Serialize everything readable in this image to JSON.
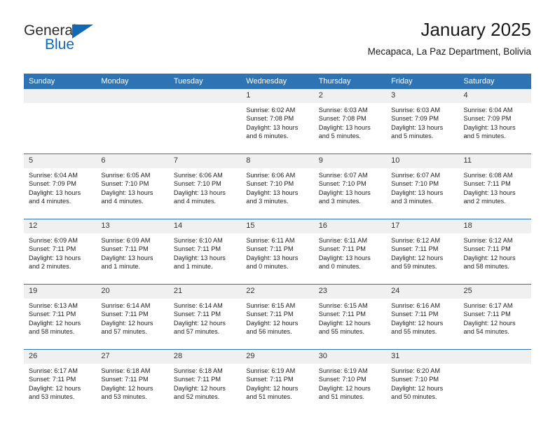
{
  "brand": {
    "name_part1": "General",
    "name_part2": "Blue"
  },
  "header": {
    "title": "January 2025",
    "subtitle": "Mecapaca, La Paz Department, Bolivia"
  },
  "colors": {
    "header_blue": "#2e74b5",
    "date_band_gray": "#f0f0f0",
    "brand_blue": "#1268b3"
  },
  "weekdays": [
    "Sunday",
    "Monday",
    "Tuesday",
    "Wednesday",
    "Thursday",
    "Friday",
    "Saturday"
  ],
  "weeks": [
    [
      {
        "day": "",
        "blank": true,
        "sunrise": "",
        "sunset": "",
        "daylight_line1": "",
        "daylight_line2": ""
      },
      {
        "day": "",
        "blank": true,
        "sunrise": "",
        "sunset": "",
        "daylight_line1": "",
        "daylight_line2": ""
      },
      {
        "day": "",
        "blank": true,
        "sunrise": "",
        "sunset": "",
        "daylight_line1": "",
        "daylight_line2": ""
      },
      {
        "day": "1",
        "sunrise": "Sunrise: 6:02 AM",
        "sunset": "Sunset: 7:08 PM",
        "daylight_line1": "Daylight: 13 hours",
        "daylight_line2": "and 6 minutes."
      },
      {
        "day": "2",
        "sunrise": "Sunrise: 6:03 AM",
        "sunset": "Sunset: 7:08 PM",
        "daylight_line1": "Daylight: 13 hours",
        "daylight_line2": "and 5 minutes."
      },
      {
        "day": "3",
        "sunrise": "Sunrise: 6:03 AM",
        "sunset": "Sunset: 7:09 PM",
        "daylight_line1": "Daylight: 13 hours",
        "daylight_line2": "and 5 minutes."
      },
      {
        "day": "4",
        "sunrise": "Sunrise: 6:04 AM",
        "sunset": "Sunset: 7:09 PM",
        "daylight_line1": "Daylight: 13 hours",
        "daylight_line2": "and 5 minutes."
      }
    ],
    [
      {
        "day": "5",
        "sunrise": "Sunrise: 6:04 AM",
        "sunset": "Sunset: 7:09 PM",
        "daylight_line1": "Daylight: 13 hours",
        "daylight_line2": "and 4 minutes."
      },
      {
        "day": "6",
        "sunrise": "Sunrise: 6:05 AM",
        "sunset": "Sunset: 7:10 PM",
        "daylight_line1": "Daylight: 13 hours",
        "daylight_line2": "and 4 minutes."
      },
      {
        "day": "7",
        "sunrise": "Sunrise: 6:06 AM",
        "sunset": "Sunset: 7:10 PM",
        "daylight_line1": "Daylight: 13 hours",
        "daylight_line2": "and 4 minutes."
      },
      {
        "day": "8",
        "sunrise": "Sunrise: 6:06 AM",
        "sunset": "Sunset: 7:10 PM",
        "daylight_line1": "Daylight: 13 hours",
        "daylight_line2": "and 3 minutes."
      },
      {
        "day": "9",
        "sunrise": "Sunrise: 6:07 AM",
        "sunset": "Sunset: 7:10 PM",
        "daylight_line1": "Daylight: 13 hours",
        "daylight_line2": "and 3 minutes."
      },
      {
        "day": "10",
        "sunrise": "Sunrise: 6:07 AM",
        "sunset": "Sunset: 7:10 PM",
        "daylight_line1": "Daylight: 13 hours",
        "daylight_line2": "and 3 minutes."
      },
      {
        "day": "11",
        "sunrise": "Sunrise: 6:08 AM",
        "sunset": "Sunset: 7:11 PM",
        "daylight_line1": "Daylight: 13 hours",
        "daylight_line2": "and 2 minutes."
      }
    ],
    [
      {
        "day": "12",
        "sunrise": "Sunrise: 6:09 AM",
        "sunset": "Sunset: 7:11 PM",
        "daylight_line1": "Daylight: 13 hours",
        "daylight_line2": "and 2 minutes."
      },
      {
        "day": "13",
        "sunrise": "Sunrise: 6:09 AM",
        "sunset": "Sunset: 7:11 PM",
        "daylight_line1": "Daylight: 13 hours",
        "daylight_line2": "and 1 minute."
      },
      {
        "day": "14",
        "sunrise": "Sunrise: 6:10 AM",
        "sunset": "Sunset: 7:11 PM",
        "daylight_line1": "Daylight: 13 hours",
        "daylight_line2": "and 1 minute."
      },
      {
        "day": "15",
        "sunrise": "Sunrise: 6:11 AM",
        "sunset": "Sunset: 7:11 PM",
        "daylight_line1": "Daylight: 13 hours",
        "daylight_line2": "and 0 minutes."
      },
      {
        "day": "16",
        "sunrise": "Sunrise: 6:11 AM",
        "sunset": "Sunset: 7:11 PM",
        "daylight_line1": "Daylight: 13 hours",
        "daylight_line2": "and 0 minutes."
      },
      {
        "day": "17",
        "sunrise": "Sunrise: 6:12 AM",
        "sunset": "Sunset: 7:11 PM",
        "daylight_line1": "Daylight: 12 hours",
        "daylight_line2": "and 59 minutes."
      },
      {
        "day": "18",
        "sunrise": "Sunrise: 6:12 AM",
        "sunset": "Sunset: 7:11 PM",
        "daylight_line1": "Daylight: 12 hours",
        "daylight_line2": "and 58 minutes."
      }
    ],
    [
      {
        "day": "19",
        "sunrise": "Sunrise: 6:13 AM",
        "sunset": "Sunset: 7:11 PM",
        "daylight_line1": "Daylight: 12 hours",
        "daylight_line2": "and 58 minutes."
      },
      {
        "day": "20",
        "sunrise": "Sunrise: 6:14 AM",
        "sunset": "Sunset: 7:11 PM",
        "daylight_line1": "Daylight: 12 hours",
        "daylight_line2": "and 57 minutes."
      },
      {
        "day": "21",
        "sunrise": "Sunrise: 6:14 AM",
        "sunset": "Sunset: 7:11 PM",
        "daylight_line1": "Daylight: 12 hours",
        "daylight_line2": "and 57 minutes."
      },
      {
        "day": "22",
        "sunrise": "Sunrise: 6:15 AM",
        "sunset": "Sunset: 7:11 PM",
        "daylight_line1": "Daylight: 12 hours",
        "daylight_line2": "and 56 minutes."
      },
      {
        "day": "23",
        "sunrise": "Sunrise: 6:15 AM",
        "sunset": "Sunset: 7:11 PM",
        "daylight_line1": "Daylight: 12 hours",
        "daylight_line2": "and 55 minutes."
      },
      {
        "day": "24",
        "sunrise": "Sunrise: 6:16 AM",
        "sunset": "Sunset: 7:11 PM",
        "daylight_line1": "Daylight: 12 hours",
        "daylight_line2": "and 55 minutes."
      },
      {
        "day": "25",
        "sunrise": "Sunrise: 6:17 AM",
        "sunset": "Sunset: 7:11 PM",
        "daylight_line1": "Daylight: 12 hours",
        "daylight_line2": "and 54 minutes."
      }
    ],
    [
      {
        "day": "26",
        "sunrise": "Sunrise: 6:17 AM",
        "sunset": "Sunset: 7:11 PM",
        "daylight_line1": "Daylight: 12 hours",
        "daylight_line2": "and 53 minutes."
      },
      {
        "day": "27",
        "sunrise": "Sunrise: 6:18 AM",
        "sunset": "Sunset: 7:11 PM",
        "daylight_line1": "Daylight: 12 hours",
        "daylight_line2": "and 53 minutes."
      },
      {
        "day": "28",
        "sunrise": "Sunrise: 6:18 AM",
        "sunset": "Sunset: 7:11 PM",
        "daylight_line1": "Daylight: 12 hours",
        "daylight_line2": "and 52 minutes."
      },
      {
        "day": "29",
        "sunrise": "Sunrise: 6:19 AM",
        "sunset": "Sunset: 7:11 PM",
        "daylight_line1": "Daylight: 12 hours",
        "daylight_line2": "and 51 minutes."
      },
      {
        "day": "30",
        "sunrise": "Sunrise: 6:19 AM",
        "sunset": "Sunset: 7:10 PM",
        "daylight_line1": "Daylight: 12 hours",
        "daylight_line2": "and 51 minutes."
      },
      {
        "day": "31",
        "sunrise": "Sunrise: 6:20 AM",
        "sunset": "Sunset: 7:10 PM",
        "daylight_line1": "Daylight: 12 hours",
        "daylight_line2": "and 50 minutes."
      },
      {
        "day": "",
        "blank": true,
        "sunrise": "",
        "sunset": "",
        "daylight_line1": "",
        "daylight_line2": ""
      }
    ]
  ]
}
